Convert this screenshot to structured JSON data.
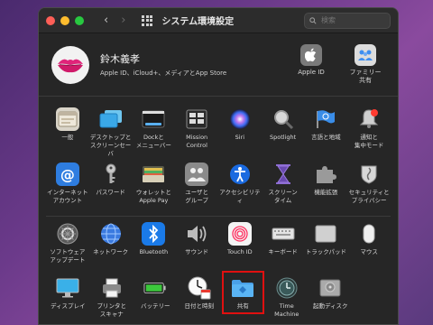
{
  "window": {
    "title": "システム環境設定",
    "search_placeholder": "検索",
    "traffic_lights": [
      "#ff5f57",
      "#febc2e",
      "#28c840"
    ]
  },
  "account": {
    "name": "鈴木義孝",
    "subtitle": "Apple ID、iCloud+、メディアとApp Store",
    "right_items": [
      {
        "label": "Apple ID",
        "icon": "apple-icon"
      },
      {
        "label": "ファミリー\n共有",
        "icon": "family-icon"
      }
    ]
  },
  "rows": [
    [
      {
        "label": "一般",
        "icon": "general-icon"
      },
      {
        "label": "デスクトップと\nスクリーンセーバ",
        "icon": "desktop-icon"
      },
      {
        "label": "Dockと\nメニューバー",
        "icon": "dock-icon"
      },
      {
        "label": "Mission\nControl",
        "icon": "mission-control-icon"
      },
      {
        "label": "Siri",
        "icon": "siri-icon"
      },
      {
        "label": "Spotlight",
        "icon": "spotlight-icon"
      },
      {
        "label": "言語と地域",
        "icon": "language-icon"
      },
      {
        "label": "通知と\n集中モード",
        "icon": "notification-icon"
      }
    ],
    [
      {
        "label": "インターネット\nアカウント",
        "icon": "internet-accounts-icon"
      },
      {
        "label": "パスワード",
        "icon": "key-icon"
      },
      {
        "label": "ウォレットと\nApple Pay",
        "icon": "wallet-icon"
      },
      {
        "label": "ユーザと\nグループ",
        "icon": "users-icon"
      },
      {
        "label": "アクセシビリティ",
        "icon": "accessibility-icon"
      },
      {
        "label": "スクリーン\nタイム",
        "icon": "hourglass-icon"
      },
      {
        "label": "機能拡張",
        "icon": "extensions-icon"
      },
      {
        "label": "セキュリティと\nプライバシー",
        "icon": "security-icon"
      }
    ],
    [
      {
        "label": "ソフトウェア\nアップデート",
        "icon": "software-update-icon"
      },
      {
        "label": "ネットワーク",
        "icon": "network-icon"
      },
      {
        "label": "Bluetooth",
        "icon": "bluetooth-icon"
      },
      {
        "label": "サウンド",
        "icon": "sound-icon"
      },
      {
        "label": "Touch ID",
        "icon": "fingerprint-icon"
      },
      {
        "label": "キーボード",
        "icon": "keyboard-icon"
      },
      {
        "label": "トラックパッド",
        "icon": "trackpad-icon"
      },
      {
        "label": "マウス",
        "icon": "mouse-icon"
      }
    ],
    [
      {
        "label": "ディスプレイ",
        "icon": "display-icon"
      },
      {
        "label": "プリンタと\nスキャナ",
        "icon": "printer-icon"
      },
      {
        "label": "バッテリー",
        "icon": "battery-icon"
      },
      {
        "label": "日付と時刻",
        "icon": "clock-icon"
      },
      {
        "label": "共有",
        "icon": "sharing-folder-icon",
        "highlighted": true
      },
      {
        "label": "Time\nMachine",
        "icon": "time-machine-icon"
      },
      {
        "label": "起動ディスク",
        "icon": "startup-disk-icon"
      }
    ]
  ]
}
